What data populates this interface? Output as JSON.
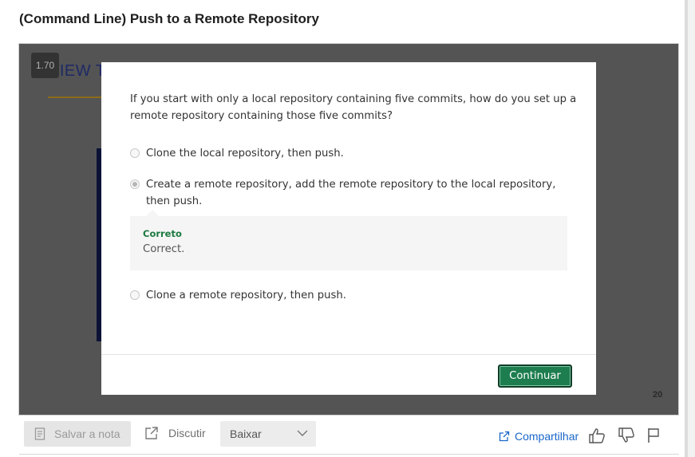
{
  "page": {
    "title": "(Command Line) Push to a Remote Repository"
  },
  "video": {
    "speed": "1.70",
    "slide_heading": "VIEW T",
    "slide_number": "20"
  },
  "quiz": {
    "question": "If you start with only a local repository containing five commits, how do you set up a remote repository containing those five commits?",
    "options": [
      {
        "label": "Clone the local repository, then push.",
        "selected": false
      },
      {
        "label": "Create a remote repository, add the remote repository to the local repository, then push.",
        "selected": true
      },
      {
        "label": "Clone a remote repository, then push.",
        "selected": false
      }
    ],
    "feedback": {
      "title": "Correto",
      "text": "Correct."
    },
    "continue_label": "Continuar"
  },
  "toolbar": {
    "save_note_label": "Salvar a nota",
    "discuss_label": "Discutir",
    "download_label": "Baixar",
    "share_label": "Compartilhar",
    "icons": {
      "save_note": "note-icon",
      "discuss": "external-link-icon",
      "download": "chevron-down-icon",
      "share": "share-icon",
      "like": "thumbs-up-icon",
      "dislike": "thumbs-down-icon",
      "flag": "flag-icon"
    }
  },
  "colors": {
    "accent_green": "#1d7d4f",
    "feedback_green": "#1b7a3f",
    "link_blue": "#1a66c9"
  }
}
